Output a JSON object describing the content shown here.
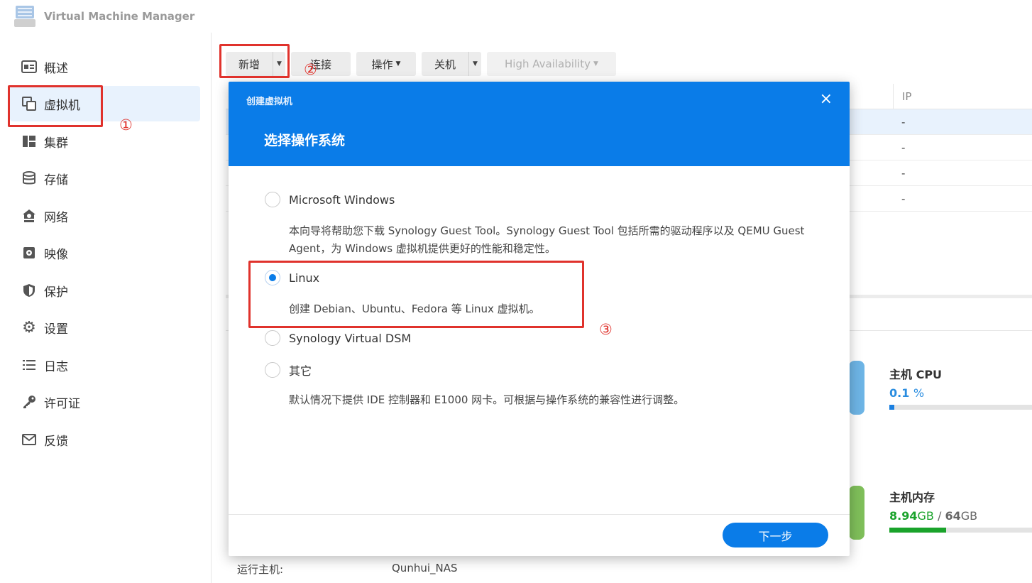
{
  "app": {
    "title": "Virtual Machine Manager"
  },
  "sidebar": {
    "items": [
      {
        "label": "概述",
        "icon": "overview-icon"
      },
      {
        "label": "虚拟机",
        "icon": "vm-icon"
      },
      {
        "label": "集群",
        "icon": "cluster-icon"
      },
      {
        "label": "存储",
        "icon": "storage-icon"
      },
      {
        "label": "网络",
        "icon": "network-icon"
      },
      {
        "label": "映像",
        "icon": "image-icon"
      },
      {
        "label": "保护",
        "icon": "shield-icon"
      },
      {
        "label": "设置",
        "icon": "gear-icon"
      },
      {
        "label": "日志",
        "icon": "log-icon"
      },
      {
        "label": "许可证",
        "icon": "key-icon"
      },
      {
        "label": "反馈",
        "icon": "mail-icon"
      }
    ]
  },
  "toolbar": {
    "add_label": "新增",
    "connect_label": "连接",
    "action_label": "操作",
    "shutdown_label": "关机",
    "ha_label": "High Availability"
  },
  "table": {
    "ip_header": "IP",
    "rows": [
      "-",
      "-",
      "-",
      "-"
    ]
  },
  "resources": {
    "cpu_title": "主机 CPU",
    "cpu_value": "0.1",
    "cpu_unit": "%",
    "cpu_fraction": 0.035,
    "mem_title": "主机内存",
    "mem_used": "8.94",
    "mem_used_unit": "GB",
    "mem_sep": "/",
    "mem_total": "64",
    "mem_total_unit": "GB",
    "mem_fraction": 0.4
  },
  "bottom": {
    "label": "运行主机:",
    "value": "Qunhui_NAS"
  },
  "modal": {
    "caption": "创建虚拟机",
    "heading": "选择操作系统",
    "close": "×",
    "options": [
      {
        "label": "Microsoft Windows",
        "desc": "本向导将帮助您下载 Synology Guest Tool。Synology Guest Tool 包括所需的驱动程序以及 QEMU Guest Agent，为 Windows 虚拟机提供更好的性能和稳定性。"
      },
      {
        "label": "Linux",
        "desc": "创建 Debian、Ubuntu、Fedora 等 Linux 虚拟机。"
      },
      {
        "label": "Synology Virtual DSM",
        "desc": ""
      },
      {
        "label": "其它",
        "desc": "默认情况下提供 IDE 控制器和 E1000 网卡。可根据与操作系统的兼容性进行调整。"
      }
    ],
    "selected": "Linux",
    "next_label": "下一步"
  },
  "annotations": {
    "n1": "①",
    "n2": "②",
    "n3": "③"
  },
  "colors": {
    "accent": "#0a7ce8",
    "annotation": "#e0322c",
    "mem_fill": "#1aa32b"
  }
}
